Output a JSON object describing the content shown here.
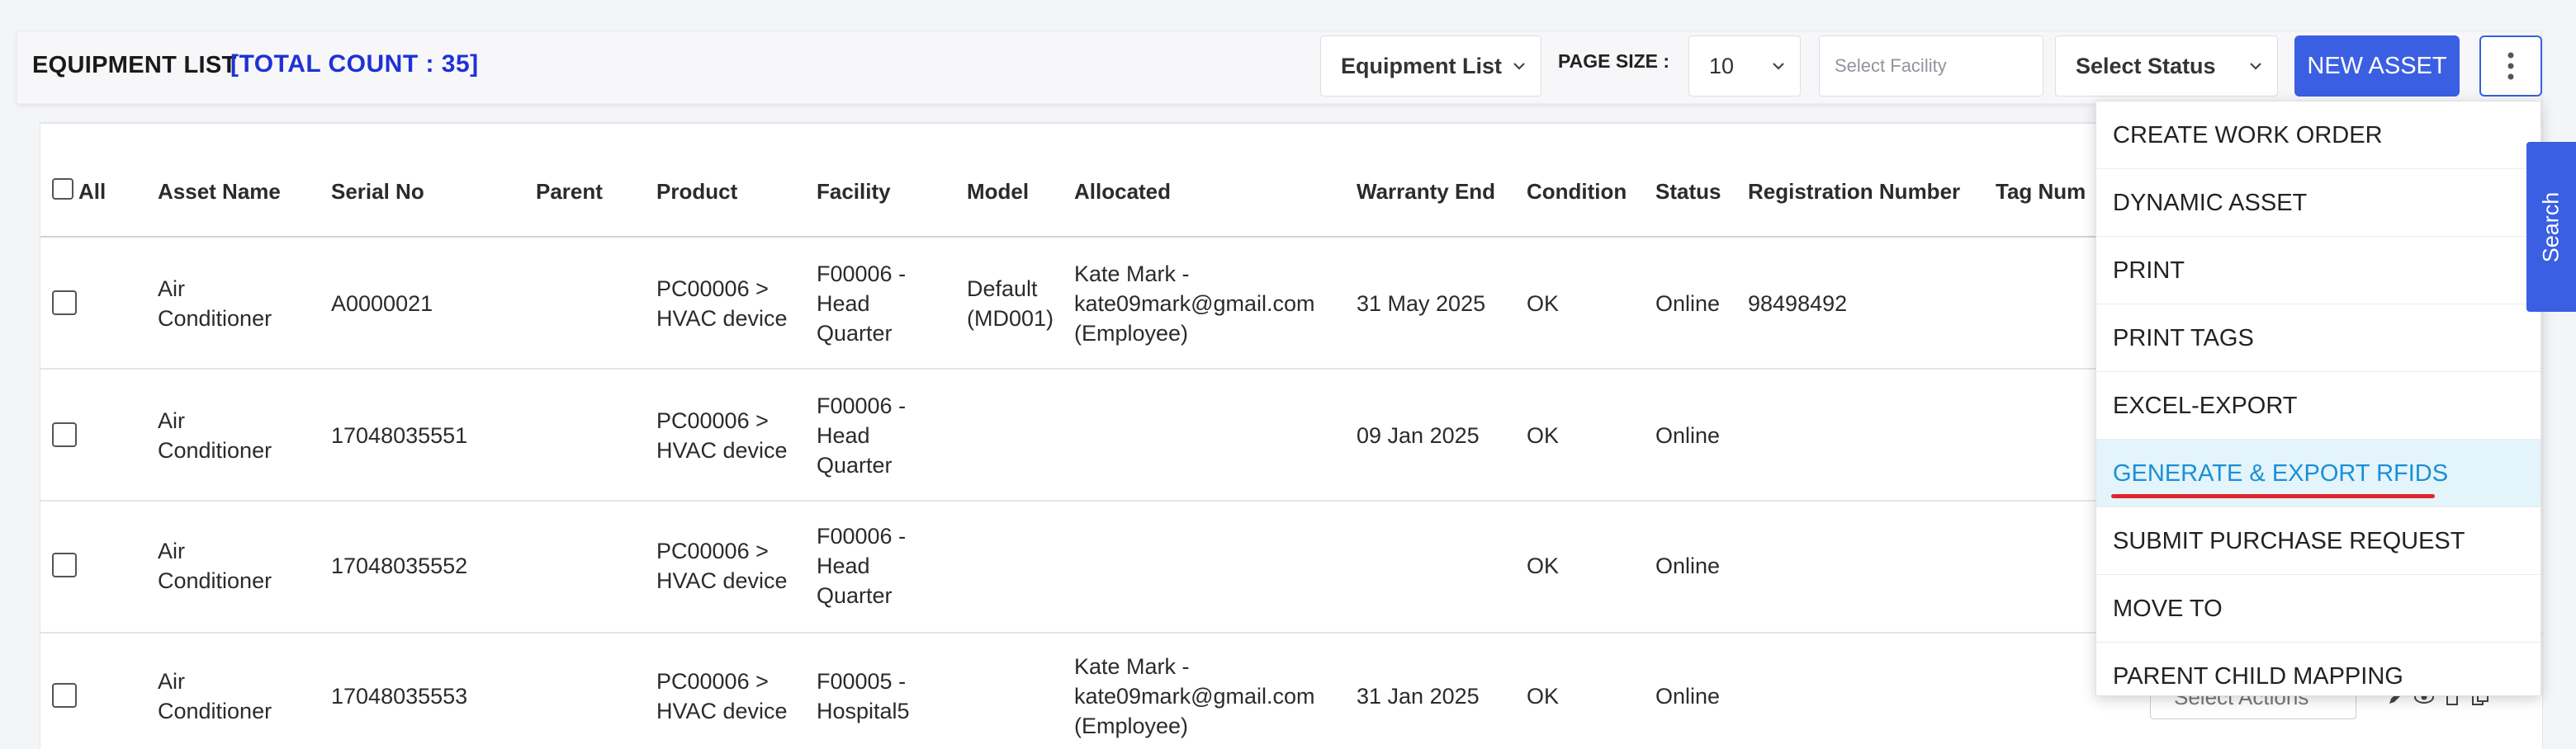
{
  "header": {
    "title": "EQUIPMENT LIST",
    "count": "[TOTAL COUNT : 35]",
    "view_select": "Equipment List",
    "page_size_label": "PAGE SIZE :",
    "page_size": "10",
    "facility_placeholder": "Select Facility",
    "status_select": "Select Status",
    "new_asset": "NEW ASSET"
  },
  "table": {
    "all_label": "All",
    "columns": [
      "Asset Name",
      "Serial No",
      "Parent",
      "Product",
      "Facility",
      "Model",
      "Allocated",
      "Warranty End",
      "Condition",
      "Status",
      "Registration Number",
      "Tag Num"
    ],
    "rows": [
      {
        "asset": "Air\nConditioner",
        "serial": "A0000021",
        "parent": "",
        "product": "PC00006 >\nHVAC device",
        "facility": "F00006 -\nHead\nQuarter",
        "model": "Default\n(MD001)",
        "allocated": "Kate Mark -\nkate09mark@gmail.com\n(Employee)",
        "warranty": "31 May 2025",
        "condition": "OK",
        "status": "Online",
        "reg": "98498492"
      },
      {
        "asset": "Air\nConditioner",
        "serial": "17048035551",
        "parent": "",
        "product": "PC00006 >\nHVAC device",
        "facility": "F00006 -\nHead\nQuarter",
        "model": "",
        "allocated": "",
        "warranty": "09 Jan 2025",
        "condition": "OK",
        "status": "Online",
        "reg": ""
      },
      {
        "asset": "Air\nConditioner",
        "serial": "17048035552",
        "parent": "",
        "product": "PC00006 >\nHVAC device",
        "facility": "F00006 -\nHead\nQuarter",
        "model": "",
        "allocated": "",
        "warranty": "",
        "condition": "OK",
        "status": "Online",
        "reg": ""
      },
      {
        "asset": "Air\nConditioner",
        "serial": "17048035553",
        "parent": "",
        "product": "PC00006 >\nHVAC device",
        "facility": "F00005 -\nHospital5",
        "model": "",
        "allocated": "Kate Mark -\nkate09mark@gmail.com\n(Employee)",
        "warranty": "31 Jan 2025",
        "condition": "OK",
        "status": "Online",
        "reg": ""
      }
    ],
    "row_action_placeholder": "Select Actions"
  },
  "menu": {
    "items": [
      "CREATE WORK ORDER",
      "DYNAMIC ASSET",
      "PRINT",
      "PRINT TAGS",
      "EXCEL-EXPORT",
      "GENERATE & EXPORT RFIDS",
      "SUBMIT PURCHASE REQUEST",
      "MOVE TO",
      "PARENT CHILD MAPPING"
    ],
    "active_index": 5
  },
  "search_tab": "Search",
  "colors": {
    "primary": "#3a5fe3",
    "count": "#1f31d6",
    "menu_active_bg": "#e3f4fa",
    "menu_active_text": "#1b8fd6",
    "underline": "#e0262b"
  }
}
